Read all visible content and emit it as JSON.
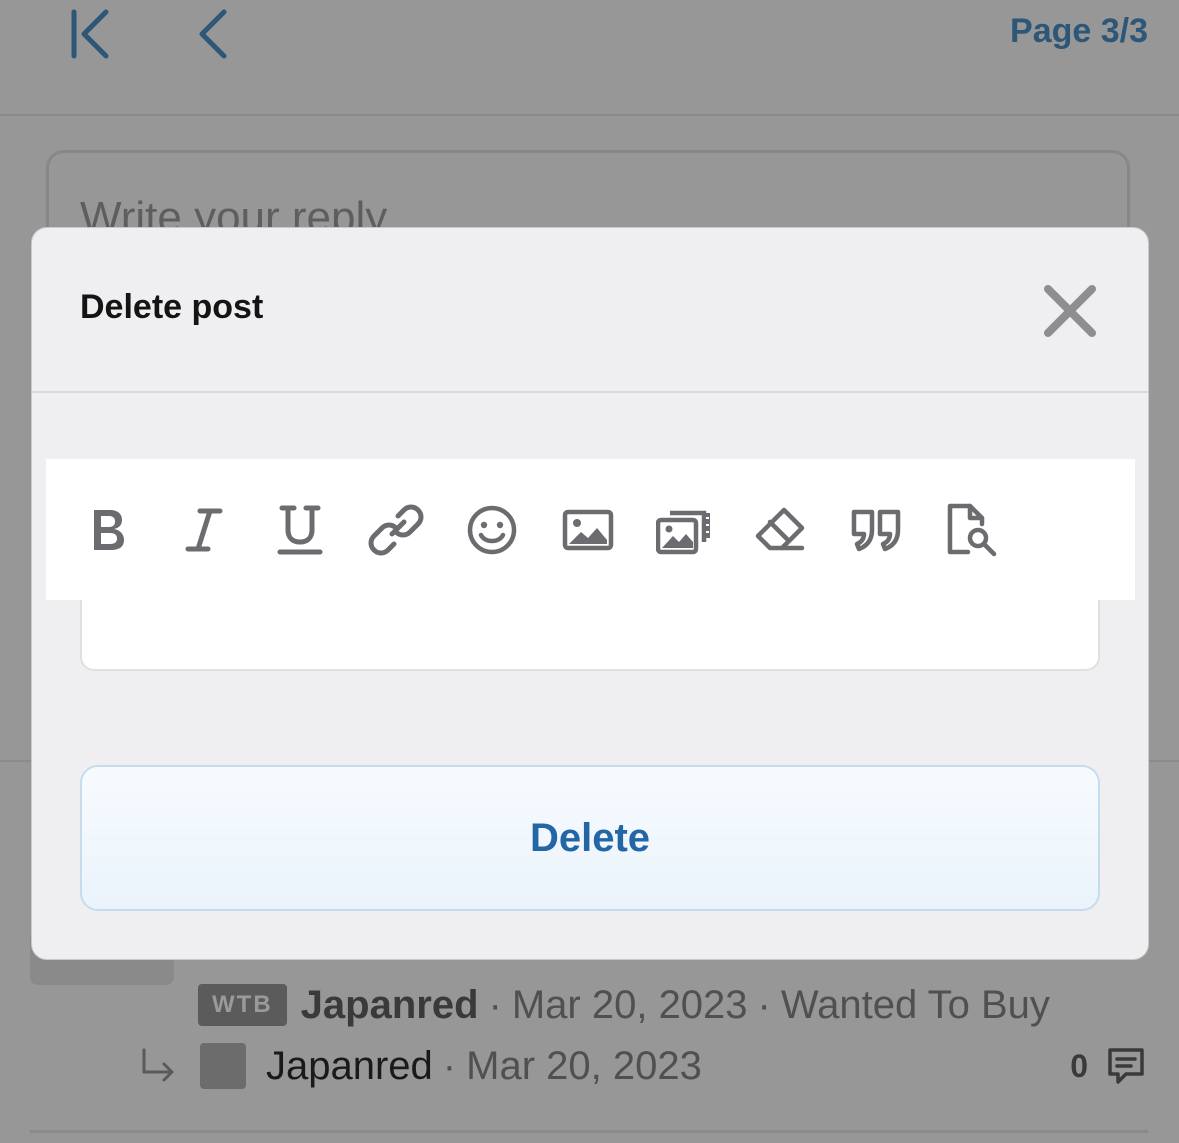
{
  "header": {
    "page_indicator": "Page 3/3",
    "nav": {
      "first_icon": "first-page-icon",
      "prev_icon": "chevron-left-icon"
    }
  },
  "reply": {
    "placeholder": "Write your reply"
  },
  "thread": {
    "prefix": "WTB",
    "author": "Japanred",
    "date": "Mar 20, 2023",
    "forum": "Wanted To Buy",
    "last_poster": "Japanred",
    "last_date": "Mar 20, 2023",
    "reply_count": "0",
    "dot": "·"
  },
  "modal": {
    "title": "Delete post",
    "close_icon": "close-icon",
    "toolbar": [
      "bold-icon",
      "italic-icon",
      "underline-icon",
      "link-icon",
      "smiley-icon",
      "image-icon",
      "media-icon",
      "eraser-icon",
      "quote-icon",
      "preview-icon"
    ],
    "delete_label": "Delete"
  },
  "colors": {
    "accent": "#2366a6",
    "overlay": "#979797",
    "modal_bg": "#efeff1",
    "icon": "#6b6b70"
  }
}
